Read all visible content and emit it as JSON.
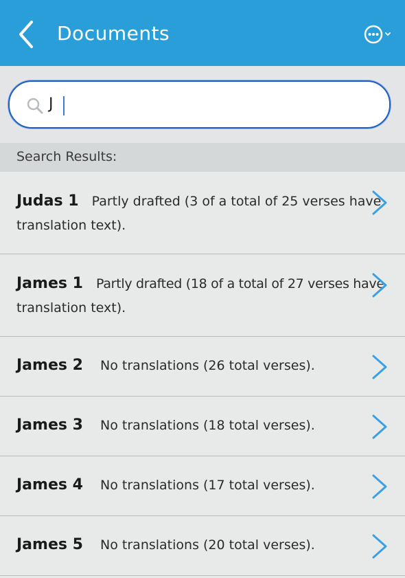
{
  "header": {
    "title": "Documents",
    "back_icon": "chevron-left-icon",
    "more_icon": "more-options-icon",
    "color": "#2a9ed9"
  },
  "search": {
    "value": "J",
    "icon": "search-icon"
  },
  "results_label": "Search Results:",
  "results": [
    {
      "title": "Judas 1",
      "desc_line1": "Partly drafted (3 of a total of 25 verses have",
      "desc_line2": "translation text)."
    },
    {
      "title": "James 1",
      "desc_line1": "Partly drafted (18 of a total of 27 verses have",
      "desc_line2": "translation text)."
    },
    {
      "title": "James 2",
      "desc_line1": "No translations (26 total verses).",
      "desc_line2": ""
    },
    {
      "title": "James 3",
      "desc_line1": "No translations (18 total verses).",
      "desc_line2": ""
    },
    {
      "title": "James 4",
      "desc_line1": "No translations (17 total verses).",
      "desc_line2": ""
    },
    {
      "title": "James 5",
      "desc_line1": "No translations (20 total verses).",
      "desc_line2": ""
    }
  ],
  "accent_color": "#3aa0e6"
}
